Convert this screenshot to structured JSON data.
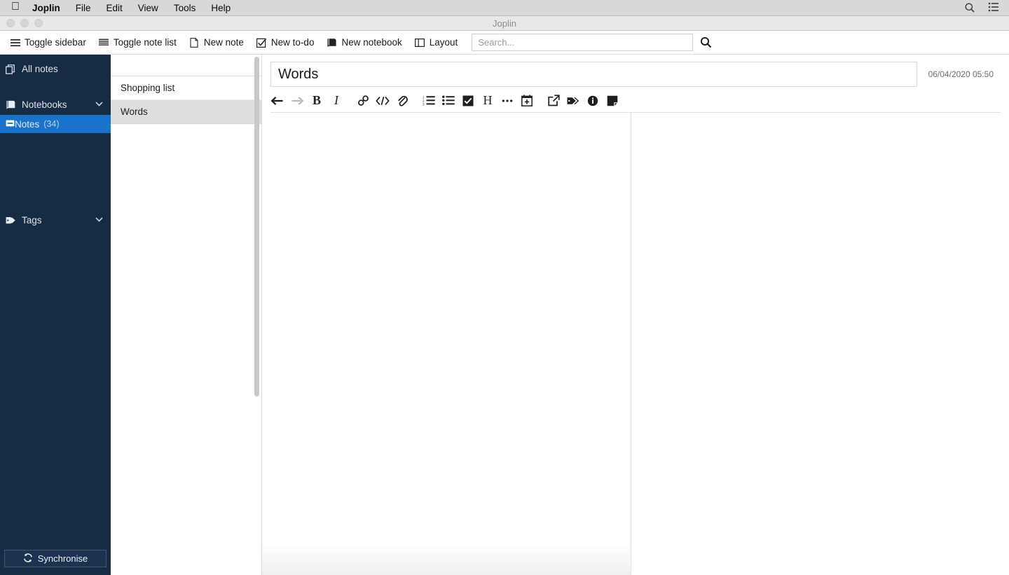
{
  "menubar": {
    "apple_icon": "apple-logo-icon",
    "app_name": "Joplin",
    "items": [
      "File",
      "Edit",
      "View",
      "Tools",
      "Help"
    ],
    "right_icons": [
      "search-icon",
      "control-center-icon"
    ]
  },
  "window": {
    "title": "Joplin",
    "traffic_lights": [
      "close-button",
      "minimize-button",
      "maximize-button"
    ]
  },
  "toolbar": {
    "buttons": [
      {
        "label": "Toggle sidebar",
        "icon": "hamburger-icon"
      },
      {
        "label": "Toggle note list",
        "icon": "list-lines-icon"
      },
      {
        "label": "New note",
        "icon": "page-icon"
      },
      {
        "label": "New to-do",
        "icon": "checkbox-icon"
      },
      {
        "label": "New notebook",
        "icon": "book-icon"
      },
      {
        "label": "Layout",
        "icon": "columns-icon"
      }
    ],
    "search": {
      "placeholder": "Search...",
      "value": "",
      "icon": "search-icon"
    }
  },
  "sidebar": {
    "all_notes": {
      "label": "All notes",
      "icon": "copy-notes-icon"
    },
    "notebooks": {
      "label": "Notebooks",
      "icon": "book-icon",
      "chevron": "chevron-down-icon"
    },
    "notebook_items": [
      {
        "label": "Notes",
        "count": "(34)",
        "icon": "notebook-icon",
        "selected": true
      }
    ],
    "tags": {
      "label": "Tags",
      "icon": "tag-icon",
      "chevron": "chevron-down-icon"
    },
    "sync": {
      "label": "Synchronise",
      "icon": "sync-icon"
    },
    "colors": {
      "background": "#162b44",
      "selected": "#1a73c8"
    }
  },
  "notelist": {
    "items": [
      {
        "title": "Shopping list",
        "selected": false
      },
      {
        "title": "Words",
        "selected": true
      }
    ]
  },
  "editor": {
    "note_title": "Words",
    "note_date": "06/04/2020 05:50",
    "body": "",
    "toolbar_icons": [
      {
        "name": "back-arrow-icon",
        "glyph": "⬅",
        "disabled": false
      },
      {
        "name": "forward-arrow-icon",
        "glyph": "➡",
        "disabled": true
      },
      {
        "name": "bold-icon",
        "glyph": "B",
        "disabled": false
      },
      {
        "name": "italic-icon",
        "glyph": "I",
        "disabled": false
      },
      {
        "name": "link-icon",
        "glyph": "🔗",
        "disabled": false
      },
      {
        "name": "code-icon",
        "glyph": "</>",
        "disabled": false
      },
      {
        "name": "attachment-icon",
        "glyph": "📎",
        "disabled": false
      },
      {
        "name": "numbered-list-icon",
        "glyph": "",
        "disabled": false
      },
      {
        "name": "bulleted-list-icon",
        "glyph": "",
        "disabled": false
      },
      {
        "name": "checkbox-list-icon",
        "glyph": "",
        "disabled": false
      },
      {
        "name": "heading-icon",
        "glyph": "H",
        "disabled": false
      },
      {
        "name": "horizontal-rule-icon",
        "glyph": "•••",
        "disabled": false
      },
      {
        "name": "insert-date-icon",
        "glyph": "",
        "disabled": false
      },
      {
        "name": "external-link-icon",
        "glyph": "",
        "disabled": false
      },
      {
        "name": "tag-icon",
        "glyph": "",
        "disabled": false
      },
      {
        "name": "note-info-icon",
        "glyph": "i",
        "disabled": false
      },
      {
        "name": "toggle-editor-icon",
        "glyph": "",
        "disabled": false
      }
    ]
  }
}
